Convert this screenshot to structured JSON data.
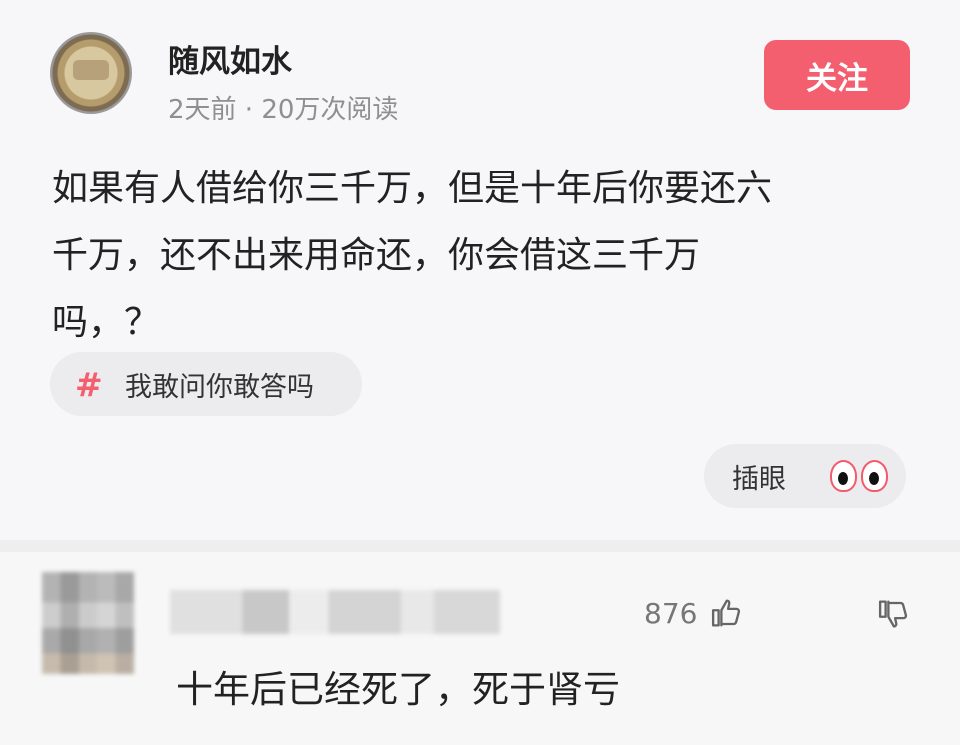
{
  "post": {
    "username": "随风如水",
    "meta": "2天前 · 20万次阅读",
    "follow_label": "关注",
    "content_lines": [
      "如果有人借给你三千万，但是十年后你要还六",
      "千万，还不出来用命还，你会借这三千万",
      "吗，？"
    ],
    "topic_hash": "#",
    "topic_text": "我敢问你敢答吗",
    "reaction_label": "插眼",
    "reaction_icon": "eyes-icon"
  },
  "comment": {
    "likes": "876",
    "like_icon": "thumbs-up-icon",
    "dislike_icon": "thumbs-down-icon",
    "text": "十年后已经死了，死于肾亏"
  },
  "colors": {
    "accent": "#f45f70",
    "background": "#f7f6f8",
    "muted_text": "#8f8f8f"
  }
}
